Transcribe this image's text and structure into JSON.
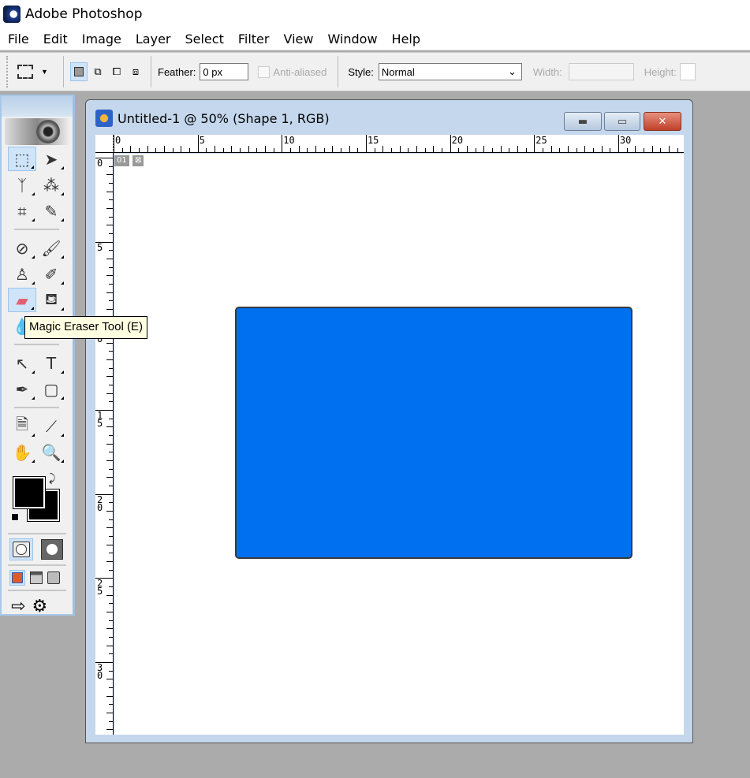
{
  "app": {
    "title": "Adobe Photoshop"
  },
  "menu": [
    "File",
    "Edit",
    "Image",
    "Layer",
    "Select",
    "Filter",
    "View",
    "Window",
    "Help"
  ],
  "options": {
    "feather_label": "Feather:",
    "feather_value": "0 px",
    "antialiased_label": "Anti-aliased",
    "antialiased_checked": false,
    "style_label": "Style:",
    "style_value": "Normal",
    "width_label": "Width:",
    "height_label": "Height:"
  },
  "tools": [
    {
      "name": "rectangular-marquee",
      "glyph": "⬚",
      "selected": true
    },
    {
      "name": "move",
      "glyph": "➤"
    },
    {
      "name": "lasso",
      "glyph": "ᛉ"
    },
    {
      "name": "magic-wand",
      "glyph": "⁂"
    },
    {
      "name": "crop",
      "glyph": "⌗"
    },
    {
      "name": "slice",
      "glyph": "✎"
    },
    {
      "name": "healing-brush",
      "glyph": "⊘"
    },
    {
      "name": "brush",
      "glyph": "🖌"
    },
    {
      "name": "clone-stamp",
      "glyph": "♙"
    },
    {
      "name": "history-brush",
      "glyph": "✐"
    },
    {
      "name": "magic-eraser",
      "glyph": "▰",
      "selected": true
    },
    {
      "name": "paint-bucket",
      "glyph": "⛾"
    },
    {
      "name": "blur",
      "glyph": "💧"
    },
    {
      "name": "dodge",
      "glyph": "●"
    },
    {
      "name": "path-selection",
      "glyph": "↖"
    },
    {
      "name": "type",
      "glyph": "T"
    },
    {
      "name": "pen",
      "glyph": "✒"
    },
    {
      "name": "rounded-rectangle",
      "glyph": "▢"
    },
    {
      "name": "notes",
      "glyph": "🗎"
    },
    {
      "name": "eyedropper",
      "glyph": "⟋"
    },
    {
      "name": "hand",
      "glyph": "✋"
    },
    {
      "name": "zoom",
      "glyph": "🔍"
    }
  ],
  "colors": {
    "foreground": "#000000",
    "background": "#000000",
    "shape_fill": "#0070f0"
  },
  "tooltip": "Magic Eraser Tool (E)",
  "document": {
    "title": "Untitled-1 @ 50% (Shape 1, RGB)",
    "zoom": "50%",
    "layer": "Shape 1",
    "mode": "RGB",
    "badge": "01"
  },
  "rulers": {
    "horizontal": [
      "0",
      "5",
      "10",
      "15",
      "20",
      "25",
      "30"
    ],
    "vertical": [
      "0",
      "5",
      "10",
      "15",
      "20",
      "25",
      "30"
    ]
  }
}
